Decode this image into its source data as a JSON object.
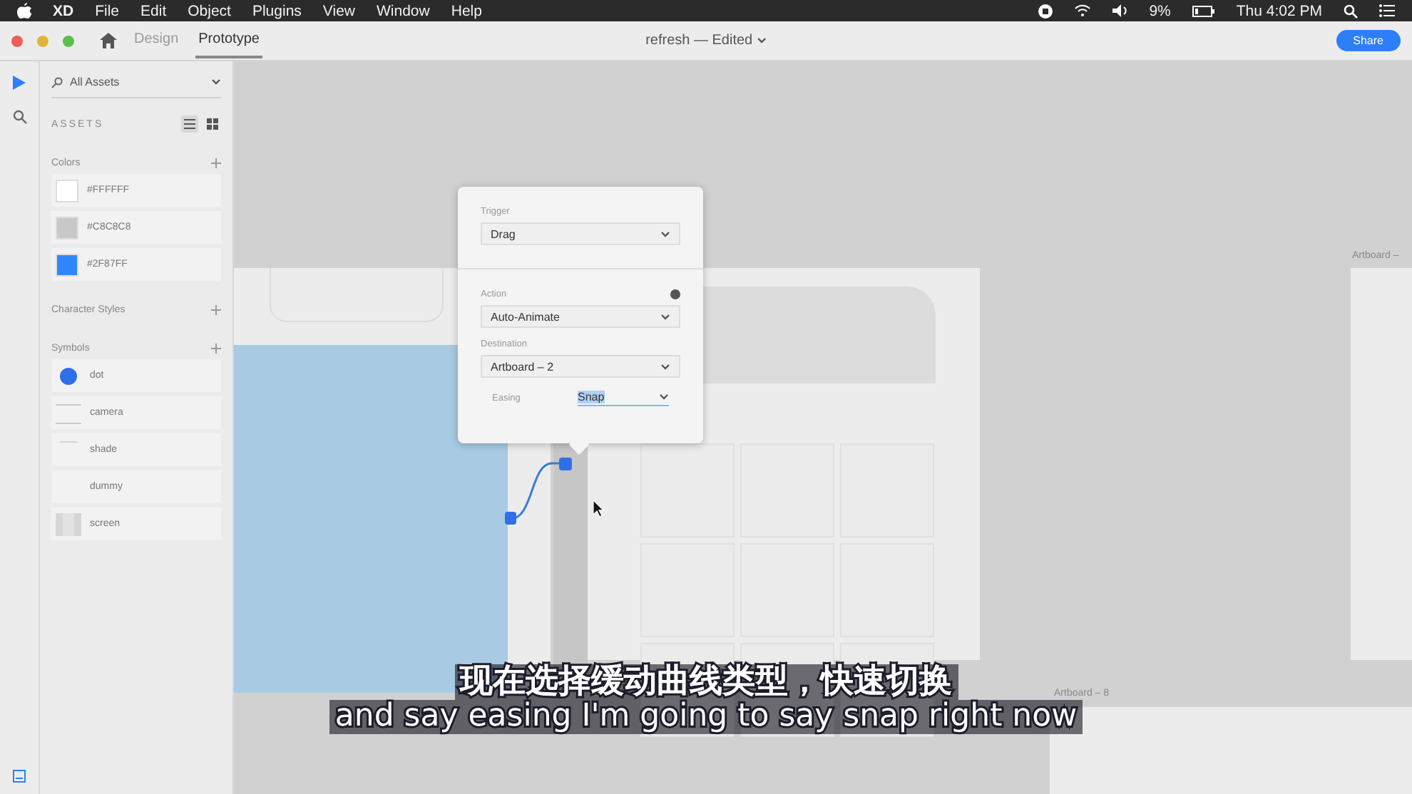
{
  "menu_bar": {
    "app": "XD",
    "items": [
      "File",
      "Edit",
      "Object",
      "Plugins",
      "View",
      "Window",
      "Help"
    ],
    "battery": "9%",
    "clock": "Thu 4:02 PM"
  },
  "title_bar": {
    "tabs": [
      {
        "label": "Design",
        "selected": false
      },
      {
        "label": "Prototype",
        "selected": true
      }
    ],
    "title": "refresh — Edited",
    "share": "Share"
  },
  "tools": [
    {
      "kind": "select",
      "selected": true
    },
    {
      "kind": "search",
      "selected": false
    }
  ],
  "assets": {
    "search": "All Assets",
    "heading": "ASSETS",
    "views": [
      {
        "kind": "list",
        "selected": true
      },
      {
        "kind": "grid",
        "selected": false
      }
    ],
    "colors_label": "Colors",
    "colors": [
      {
        "label": "#FFFFFF",
        "color": "#ffffff"
      },
      {
        "label": "#C8C8C8",
        "color": "#c8c8c8"
      },
      {
        "label": "#2F87FF",
        "color": "#2f87ff"
      }
    ],
    "character_styles_label": "Character Styles",
    "symbols_label": "Symbols",
    "symbols": [
      {
        "label": "dot",
        "kind": "dot"
      },
      {
        "label": "camera",
        "kind": "lines"
      },
      {
        "label": "shade",
        "kind": "line"
      },
      {
        "label": "dummy",
        "kind": "blank"
      },
      {
        "label": "screen",
        "kind": "screen"
      }
    ]
  },
  "canvas": {
    "artboard_labels": [
      "Artboard – ",
      "Artboard – 8"
    ],
    "popup": {
      "trigger_label": "Trigger",
      "trigger": "Drag",
      "action_label": "Action",
      "action": "Auto-Animate",
      "destination_label": "Destination",
      "destination": "Artboard – 2",
      "easing_label": "Easing",
      "easing": "Snap"
    }
  },
  "subtitles": [
    "现在选择缓动曲线类型，快速切换",
    "and say easing I'm going to say snap right now"
  ]
}
